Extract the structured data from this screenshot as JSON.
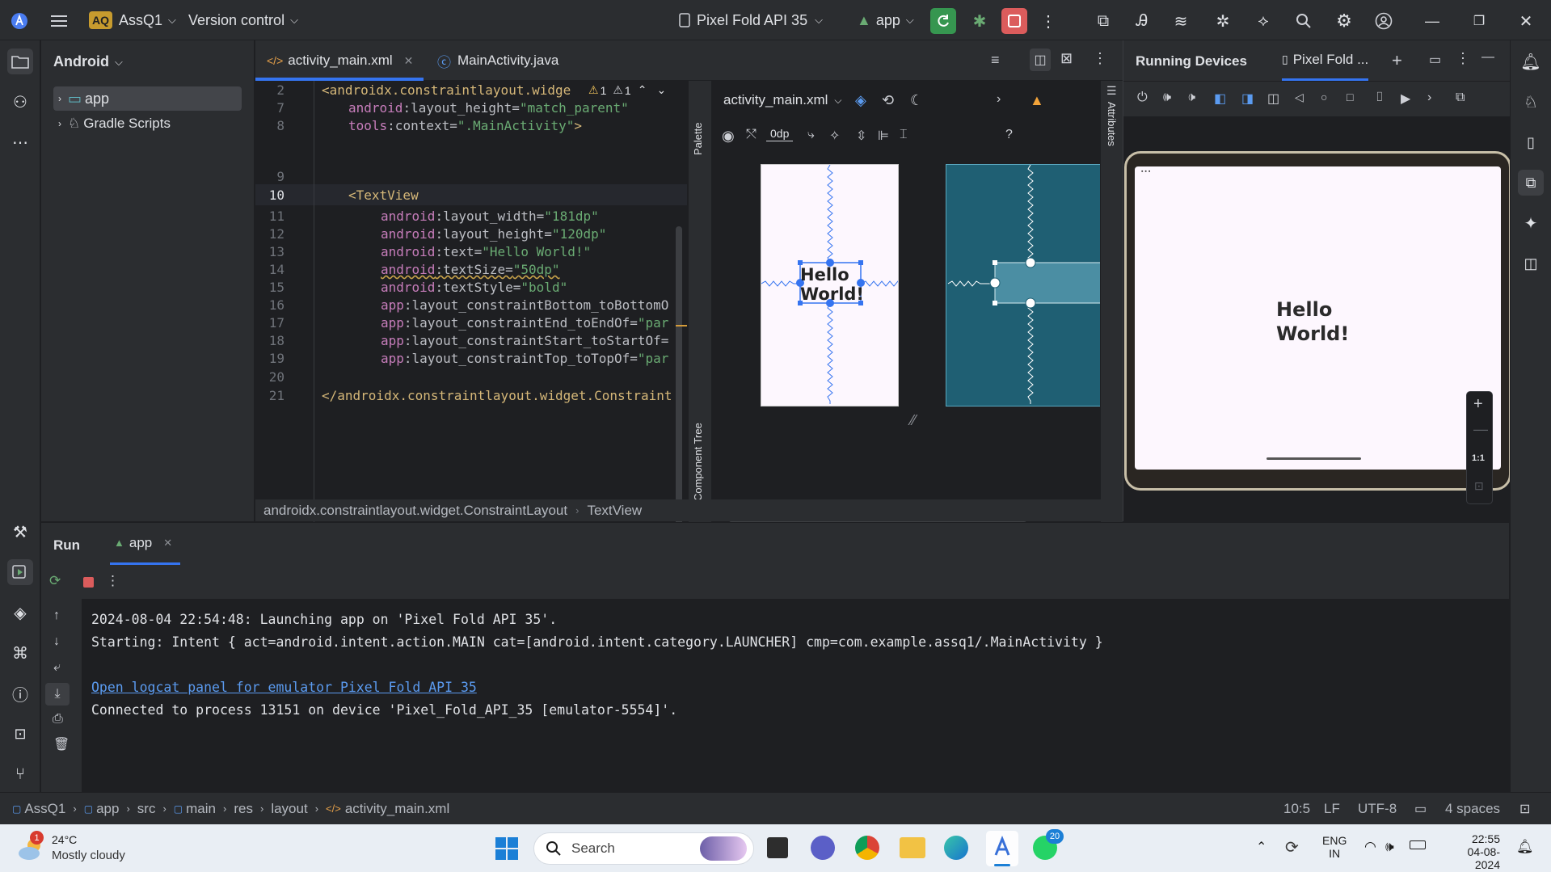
{
  "titlebar": {
    "project_badge": "AQ",
    "project_name": "AssQ1",
    "vcs": "Version control",
    "device": "Pixel Fold API 35",
    "run_config": "app"
  },
  "project_panel": {
    "view": "Android",
    "items": [
      {
        "label": "app"
      },
      {
        "label": "Gradle Scripts"
      }
    ]
  },
  "editor": {
    "tabs": [
      {
        "label": "activity_main.xml"
      },
      {
        "label": "MainActivity.java"
      }
    ],
    "warnings": {
      "w1": "1",
      "w2": "1"
    },
    "line_numbers": [
      "2",
      "7",
      "8",
      "9",
      "10",
      "11",
      "12",
      "13",
      "14",
      "15",
      "16",
      "17",
      "18",
      "19",
      "20",
      "21"
    ],
    "code": {
      "l2_tag": "<androidx.constraintlayout.widge",
      "l7_ns": "android",
      "l7_attr": ":layout_height=",
      "l7_val": "\"match_parent\"",
      "l8_ns": "tools",
      "l8_attr": ":context=",
      "l8_val": "\".MainActivity\"",
      "l8_end": ">",
      "l10_tag": "<TextView",
      "l11_ns": "android",
      "l11_attr": ":layout_width=",
      "l11_val": "\"181dp\"",
      "l12_ns": "android",
      "l12_attr": ":layout_height=",
      "l12_val": "\"120dp\"",
      "l13_ns": "android",
      "l13_attr": ":text=",
      "l13_val": "\"Hello World!\"",
      "l14_ns": "android",
      "l14_attr": ":textSize=",
      "l14_val": "\"50dp\"",
      "l15_ns": "android",
      "l15_attr": ":textStyle=",
      "l15_val": "\"bold\"",
      "l16_ns": "app",
      "l16_attr": ":layout_constraintBottom_toBottomO",
      "l17_ns": "app",
      "l17_attr": ":layout_constraintEnd_toEndOf=",
      "l17_val": "\"par",
      "l18_ns": "app",
      "l18_attr": ":layout_constraintStart_toStartOf=",
      "l19_ns": "app",
      "l19_attr": ":layout_constraintTop_toTopOf=",
      "l19_val": "\"par",
      "l21_tag": "</androidx.constraintlayout.widget.Constraint"
    }
  },
  "design": {
    "file": "activity_main.xml",
    "margin": "0dp",
    "palette": "Palette",
    "component_tree": "Component Tree",
    "attributes": "Attributes",
    "preview_text_1": "Hello",
    "preview_text_2": "World!",
    "help": "?"
  },
  "running_devices": {
    "title": "Running Devices",
    "tab": "Pixel Fold ...",
    "screen_text_1": "Hello",
    "screen_text_2": "World!",
    "zoom_label": "1:1"
  },
  "breadcrumbs": [
    "androidx.constraintlayout.widget.ConstraintLayout",
    "TextView"
  ],
  "run_panel": {
    "title": "Run",
    "tab": "app",
    "lines": [
      "2024-08-04 22:54:48: Launching app on 'Pixel Fold API 35'.",
      "Starting: Intent { act=android.intent.action.MAIN cat=[android.intent.category.LAUNCHER] cmp=com.example.assq1/.MainActivity }",
      "Open logcat panel for emulator Pixel Fold API 35",
      "Connected to process 13151 on device 'Pixel_Fold_API_35 [emulator-5554]'."
    ]
  },
  "statusbar": {
    "path": [
      "AssQ1",
      "app",
      "src",
      "main",
      "res",
      "layout",
      "activity_main.xml"
    ],
    "position": "10:5",
    "line_sep": "LF",
    "encoding": "UTF-8",
    "indent": "4 spaces"
  },
  "taskbar": {
    "weather_temp": "24°C",
    "weather_desc": "Mostly cloudy",
    "weather_badge": "1",
    "search": "Search",
    "whatsapp_badge": "20",
    "lang_1": "ENG",
    "lang_2": "IN",
    "time": "22:55",
    "date": "04-08-2024"
  },
  "colors": {
    "accent": "#3574f0",
    "run_green": "#369650",
    "stop_red": "#db5c5c",
    "blueprint": "#1f5f73"
  }
}
